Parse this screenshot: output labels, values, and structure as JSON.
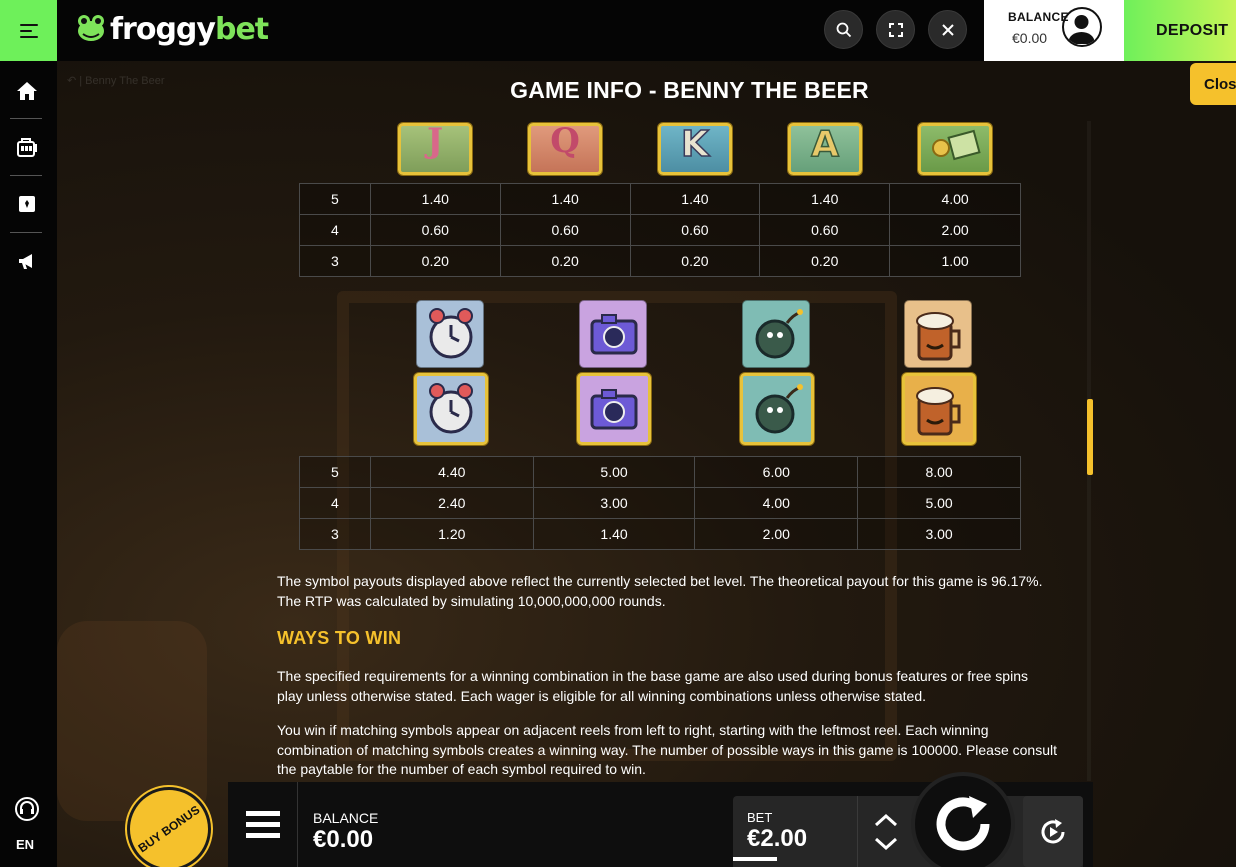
{
  "site": {
    "logo_part1": "froggy",
    "logo_part2": "bet"
  },
  "header": {
    "balance_label": "BALANCE",
    "balance_value": "€0.00",
    "deposit_label": "DEPOSIT"
  },
  "sidebar": {
    "language": "EN"
  },
  "game": {
    "breadcrumb": "↶  |  Benny The Beer",
    "close_label": "Close",
    "title": "GAME INFO - BENNY THE BEER",
    "table1": {
      "rows": [
        {
          "count": "5",
          "values": [
            "1.40",
            "1.40",
            "1.40",
            "1.40",
            "4.00"
          ]
        },
        {
          "count": "4",
          "values": [
            "0.60",
            "0.60",
            "0.60",
            "0.60",
            "2.00"
          ]
        },
        {
          "count": "3",
          "values": [
            "0.20",
            "0.20",
            "0.20",
            "0.20",
            "1.00"
          ]
        }
      ]
    },
    "table2": {
      "rows": [
        {
          "count": "5",
          "values": [
            "4.40",
            "5.00",
            "6.00",
            "8.00"
          ]
        },
        {
          "count": "4",
          "values": [
            "2.40",
            "3.00",
            "4.00",
            "5.00"
          ]
        },
        {
          "count": "3",
          "values": [
            "1.20",
            "1.40",
            "2.00",
            "3.00"
          ]
        }
      ]
    },
    "symbols_row1": [
      "J",
      "Q",
      "K",
      "A",
      "coins"
    ],
    "symbols_row2": [
      "alarm-clock",
      "camera",
      "bomb",
      "beer-mug"
    ],
    "rtp_text": "The symbol payouts displayed above reflect the currently selected bet level. The theoretical payout for this game is 96.17%. The RTP was calculated by simulating 10,000,000,000 rounds.",
    "ways_heading": "WAYS TO WIN",
    "ways_text1": "The specified requirements for a winning combination in the base game are also used during bonus features or free spins play unless otherwise stated. Each wager is eligible for all winning combinations unless otherwise stated.",
    "ways_text2": "You win if matching symbols appear on adjacent reels from left to right, starting with the leftmost reel. Each winning combination of matching symbols creates a winning way. The number of possible ways in this game is 100000. Please consult the paytable for the number of each symbol required to win."
  },
  "controls": {
    "buy_bonus": "BUY BONUS",
    "balance_label": "BALANCE",
    "balance_value": "€0.00",
    "bet_label": "BET",
    "bet_value": "€2.00"
  },
  "colors": {
    "accent_green": "#6ef05a",
    "accent_yellow": "#f5c12c",
    "background": "#1b1510"
  }
}
